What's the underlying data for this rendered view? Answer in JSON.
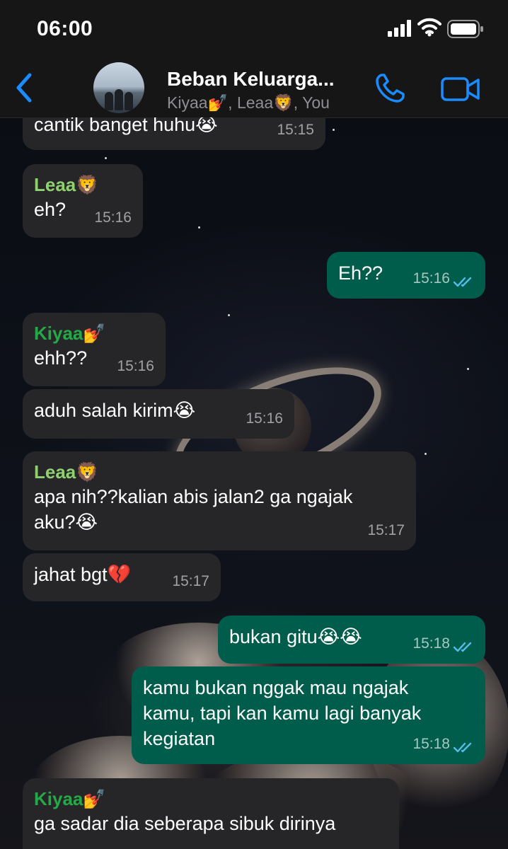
{
  "status_bar": {
    "time": "06:00"
  },
  "header": {
    "title": "Beban Keluarga...",
    "members": "Kiyaa💅, Leaa🦁, You"
  },
  "messages": [
    {
      "direction": "in",
      "sender": "",
      "text": "cantik banget huhu😭",
      "time": "15:15"
    },
    {
      "direction": "in",
      "sender": "Leaa🦁",
      "text": "eh?",
      "time": "15:16"
    },
    {
      "direction": "out",
      "sender": "",
      "text": "Eh??",
      "time": "15:16",
      "status": "read"
    },
    {
      "direction": "in",
      "sender": "Kiyaa💅",
      "text": "ehh??",
      "time": "15:16"
    },
    {
      "direction": "in",
      "sender": "",
      "text": "aduh salah kirim😭",
      "time": "15:16"
    },
    {
      "direction": "in",
      "sender": "Leaa🦁",
      "text": "apa nih??kalian abis jalan2 ga ngajak\naku?😭",
      "time": "15:17"
    },
    {
      "direction": "in",
      "sender": "",
      "text": "jahat bgt💔",
      "time": "15:17"
    },
    {
      "direction": "out",
      "sender": "",
      "text": "bukan gitu😭😭",
      "time": "15:18",
      "status": "read"
    },
    {
      "direction": "out",
      "sender": "",
      "text": "kamu bukan nggak mau ngajak\nkamu, tapi kan kamu lagi banyak\nkegiatan",
      "time": "15:18",
      "status": "read"
    },
    {
      "direction": "in",
      "sender": "Kiyaa💅",
      "text": "ga sadar dia seberapa sibuk dirinya",
      "time": ""
    }
  ],
  "colors": {
    "incoming_bubble": "#262628",
    "outgoing_bubble": "#005c4b",
    "accent_blue": "#1a8cff",
    "sender_leaa": "#8fd071",
    "sender_kiyaa": "#25a848",
    "read_ticks": "#53bdeb"
  }
}
